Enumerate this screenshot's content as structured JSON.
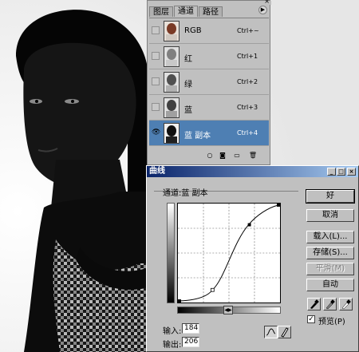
{
  "palette": {
    "tabs": [
      "图层",
      "通道",
      "路径"
    ],
    "active_tab": "通道",
    "channels": [
      {
        "name": "RGB",
        "shortcut": "Ctrl+~",
        "selected": false
      },
      {
        "name": "红",
        "shortcut": "Ctrl+1",
        "selected": false
      },
      {
        "name": "绿",
        "shortcut": "Ctrl+2",
        "selected": false
      },
      {
        "name": "蓝",
        "shortcut": "Ctrl+3",
        "selected": false
      },
      {
        "name": "蓝 副本",
        "shortcut": "Ctrl+4",
        "selected": true
      }
    ]
  },
  "dialog": {
    "title": "曲线",
    "channel_label": "通道:蓝 副本",
    "buttons": {
      "ok": "好",
      "cancel": "取消",
      "load": "载入(L)...",
      "save": "存储(S)...",
      "smooth": "平滑(M)",
      "auto": "自动"
    },
    "preview_label": "预览(P)",
    "preview_checked": true,
    "input_label": "输入:",
    "input_value": "184",
    "output_label": "输出:",
    "output_value": "206"
  },
  "colors": {
    "selection": "#4e7fb3",
    "titlebar": "#0a246a",
    "chrome": "#c0c0c0"
  },
  "icons": [
    "eye-icon",
    "curve-tool-icon",
    "pencil-tool-icon",
    "black-eyedropper-icon",
    "gray-eyedropper-icon",
    "white-eyedropper-icon"
  ]
}
